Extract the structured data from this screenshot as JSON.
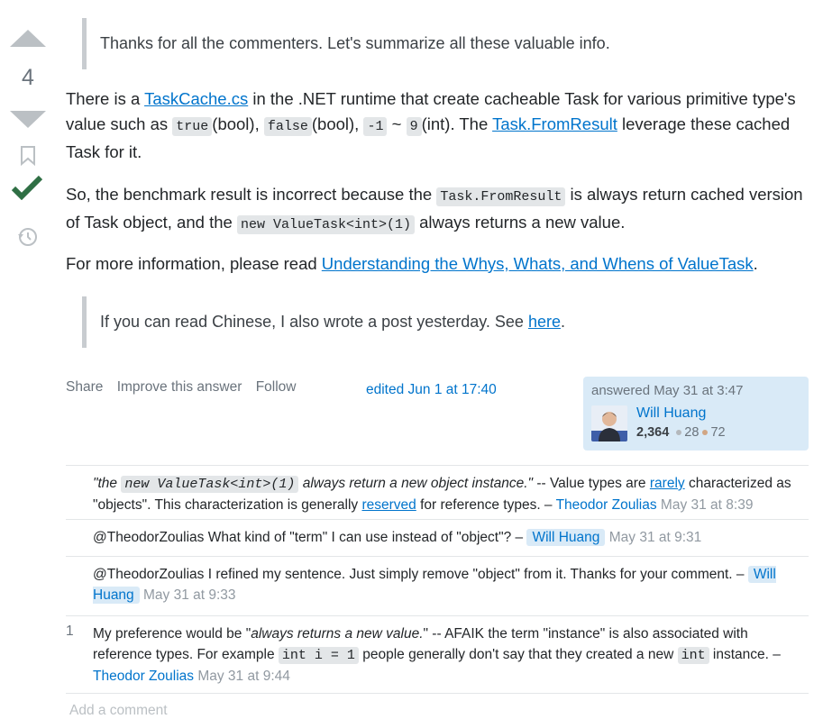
{
  "vote": {
    "count": "4"
  },
  "answer": {
    "bq1": "Thanks for all the commenters. Let's summarize all these valuable info.",
    "p1": {
      "t1": "There is a ",
      "link1": "TaskCache.cs",
      "t2": " in the .NET runtime that create cacheable Task for various primitive type's value such as ",
      "c1": "true",
      "t3": "(bool), ",
      "c2": "false",
      "t4": "(bool), ",
      "c3": "-1",
      "t5": " ~ ",
      "c4": "9",
      "t6": "(int). The ",
      "link2": "Task.FromResult",
      "t7": " leverage these cached Task for it."
    },
    "p2": {
      "t1": "So, the benchmark result is incorrect because the ",
      "c1": "Task.FromResult",
      "t2": " is always return cached version of Task object, and the ",
      "c2": "new ValueTask<int>(1)",
      "t3": " always returns a new value."
    },
    "p3": {
      "t1": "For more information, please read ",
      "link": "Understanding the Whys, Whats, and Whens of ValueTask",
      "t2": "."
    },
    "bq2": {
      "t1": "If you can read Chinese, I also wrote a post yesterday. See ",
      "link": "here",
      "t2": "."
    }
  },
  "menu": {
    "share": "Share",
    "improve": "Improve this answer",
    "follow": "Follow"
  },
  "edited": "edited Jun 1 at 17:40",
  "usercard": {
    "answered": "answered May 31 at 3:47",
    "name": "Will Huang",
    "rep": "2,364",
    "silver": "28",
    "bronze": "72",
    "silver_color": "#b4b8bc",
    "bronze_color": "#d1a684"
  },
  "comments": [
    {
      "score": "",
      "q_open": "\"the ",
      "q_code": "new ValueTask<int>(1)",
      "q_rest": " always return a new object instance.\"",
      "t1": " -- Value types are ",
      "link1": "rarely",
      "t2": " characterized as \"objects\". This characterization is generally ",
      "link2": "reserved",
      "t3": " for reference types. – ",
      "user": "Theodor Zoulias",
      "date": "May 31 at 8:39"
    },
    {
      "score": "",
      "text": "@TheodorZoulias What kind of \"term\" I can use instead of \"object\"? – ",
      "user": "Will Huang",
      "date": "May 31 at 9:31"
    },
    {
      "score": "",
      "text": "@TheodorZoulias I refined my sentence. Just simply remove \"object\" from it. Thanks for your comment. – ",
      "user": "Will Huang",
      "date": "May 31 at 9:33"
    },
    {
      "score": "1",
      "t1": "My preference would be \"",
      "em": "always returns a new value.",
      "t2": "\" -- AFAIK the term \"instance\" is also associated with reference types. For example ",
      "c1": "int i = 1",
      "t3": " people generally don't say that they created a new ",
      "c2": "int",
      "t4": " instance. – ",
      "user": "Theodor Zoulias",
      "date": "May 31 at 9:44"
    }
  ],
  "add_comment": "Add a comment"
}
